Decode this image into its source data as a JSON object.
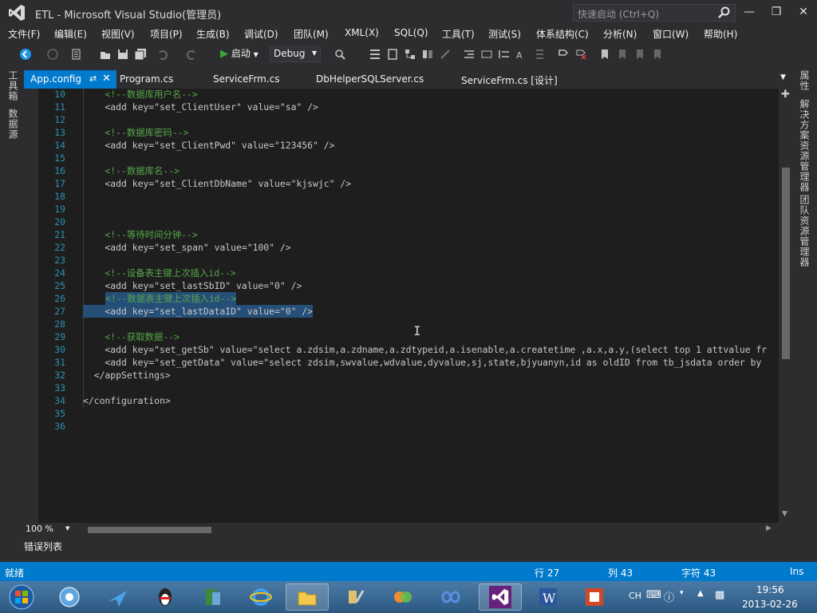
{
  "window": {
    "title": "ETL - Microsoft Visual Studio(管理员)",
    "quick_launch_placeholder": "快速启动 (Ctrl+Q)"
  },
  "menu": [
    "文件(F)",
    "编辑(E)",
    "视图(V)",
    "项目(P)",
    "生成(B)",
    "调试(D)",
    "团队(M)",
    "XML(X)",
    "SQL(Q)",
    "工具(T)",
    "测试(S)",
    "体系结构(C)",
    "分析(N)",
    "窗口(W)",
    "帮助(H)"
  ],
  "toolbar": {
    "start_label": "启动",
    "config_value": "Debug"
  },
  "left_panels": [
    "工具箱",
    "数据源"
  ],
  "right_panels": [
    "属性",
    "解决方案资源管理器",
    "团队资源管理器"
  ],
  "tabs": [
    {
      "label": "App.config",
      "active": true
    },
    {
      "label": "Program.cs"
    },
    {
      "label": "ServiceFrm.cs"
    },
    {
      "label": "DbHelperSQLServer.cs"
    },
    {
      "label": "ServiceFrm.cs [设计]"
    }
  ],
  "code_lines": [
    {
      "n": "10",
      "text": "    <!--数据库用户名-->"
    },
    {
      "n": "11",
      "text": "    <add key=\"set_ClientUser\" value=\"sa\" />"
    },
    {
      "n": "12",
      "text": ""
    },
    {
      "n": "13",
      "text": "    <!--数据库密码-->"
    },
    {
      "n": "14",
      "text": "    <add key=\"set_ClientPwd\" value=\"123456\" />"
    },
    {
      "n": "15",
      "text": ""
    },
    {
      "n": "16",
      "text": "    <!--数据库名-->"
    },
    {
      "n": "17",
      "text": "    <add key=\"set_ClientDbName\" value=\"kjswjc\" />"
    },
    {
      "n": "18",
      "text": ""
    },
    {
      "n": "19",
      "text": ""
    },
    {
      "n": "20",
      "text": ""
    },
    {
      "n": "21",
      "text": "    <!--等待时间分钟-->"
    },
    {
      "n": "22",
      "text": "    <add key=\"set_span\" value=\"100\" />"
    },
    {
      "n": "23",
      "text": ""
    },
    {
      "n": "24",
      "text": "    <!--设备表主键上次插入id-->"
    },
    {
      "n": "25",
      "text": "    <add key=\"set_lastSbID\" value=\"0\" />"
    },
    {
      "n": "26",
      "text": "    <!--数据表主键上次插入id-->"
    },
    {
      "n": "27",
      "text": "    <add key=\"set_lastDataID\" value=\"0\" />"
    },
    {
      "n": "28",
      "text": ""
    },
    {
      "n": "29",
      "text": "    <!--获取数据-->"
    },
    {
      "n": "30",
      "text": "    <add key=\"set_getSb\" value=\"select a.zdsim,a.zdname,a.zdtypeid,a.isenable,a.createtime ,a.x,a.y,(select top 1 attvalue fr"
    },
    {
      "n": "31",
      "text": "    <add key=\"set_getData\" value=\"select zdsim,swvalue,wdvalue,dyvalue,sj,state,bjyuanyn,id as oldID from tb_jsdata order by"
    },
    {
      "n": "32",
      "text": "  </appSettings>"
    },
    {
      "n": "33",
      "text": ""
    },
    {
      "n": "34",
      "text": "</configuration>"
    },
    {
      "n": "35",
      "text": ""
    },
    {
      "n": "36",
      "text": ""
    }
  ],
  "zoom": "100 %",
  "error_list_tab": "错误列表",
  "status": {
    "ready": "就绪",
    "line": "行 27",
    "col": "列 43",
    "char": "字符 43",
    "mode": "Ins"
  },
  "tray": {
    "lang": "CH",
    "time": "19:56",
    "date": "2013-02-26"
  },
  "colors": {
    "accent": "#007acc",
    "comment": "#57a64a",
    "selection": "#264f78",
    "editor_bg": "#1e1e1e"
  }
}
